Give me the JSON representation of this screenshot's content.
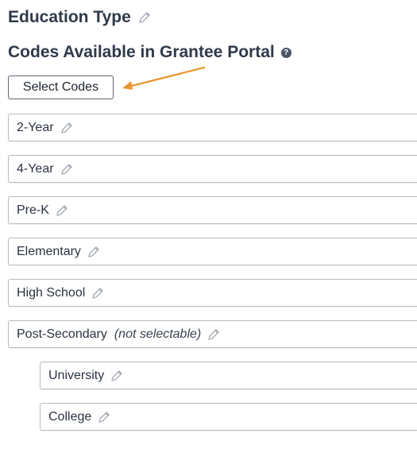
{
  "education_heading": "Education Type",
  "codes_heading": "Codes Available in Grantee Portal",
  "help_icon_glyph": "?",
  "select_codes_label": "Select Codes",
  "colors": {
    "arrow": "#e8962e",
    "heading": "#2f3a4b",
    "border": "#b5bbc3"
  },
  "codes": [
    {
      "label": "2-Year",
      "note": ""
    },
    {
      "label": "4-Year",
      "note": ""
    },
    {
      "label": "Pre-K",
      "note": ""
    },
    {
      "label": "Elementary",
      "note": ""
    },
    {
      "label": "High School",
      "note": ""
    },
    {
      "label": "Post-Secondary",
      "note": "(not selectable)"
    },
    {
      "label": "University",
      "note": ""
    },
    {
      "label": "College",
      "note": ""
    }
  ]
}
